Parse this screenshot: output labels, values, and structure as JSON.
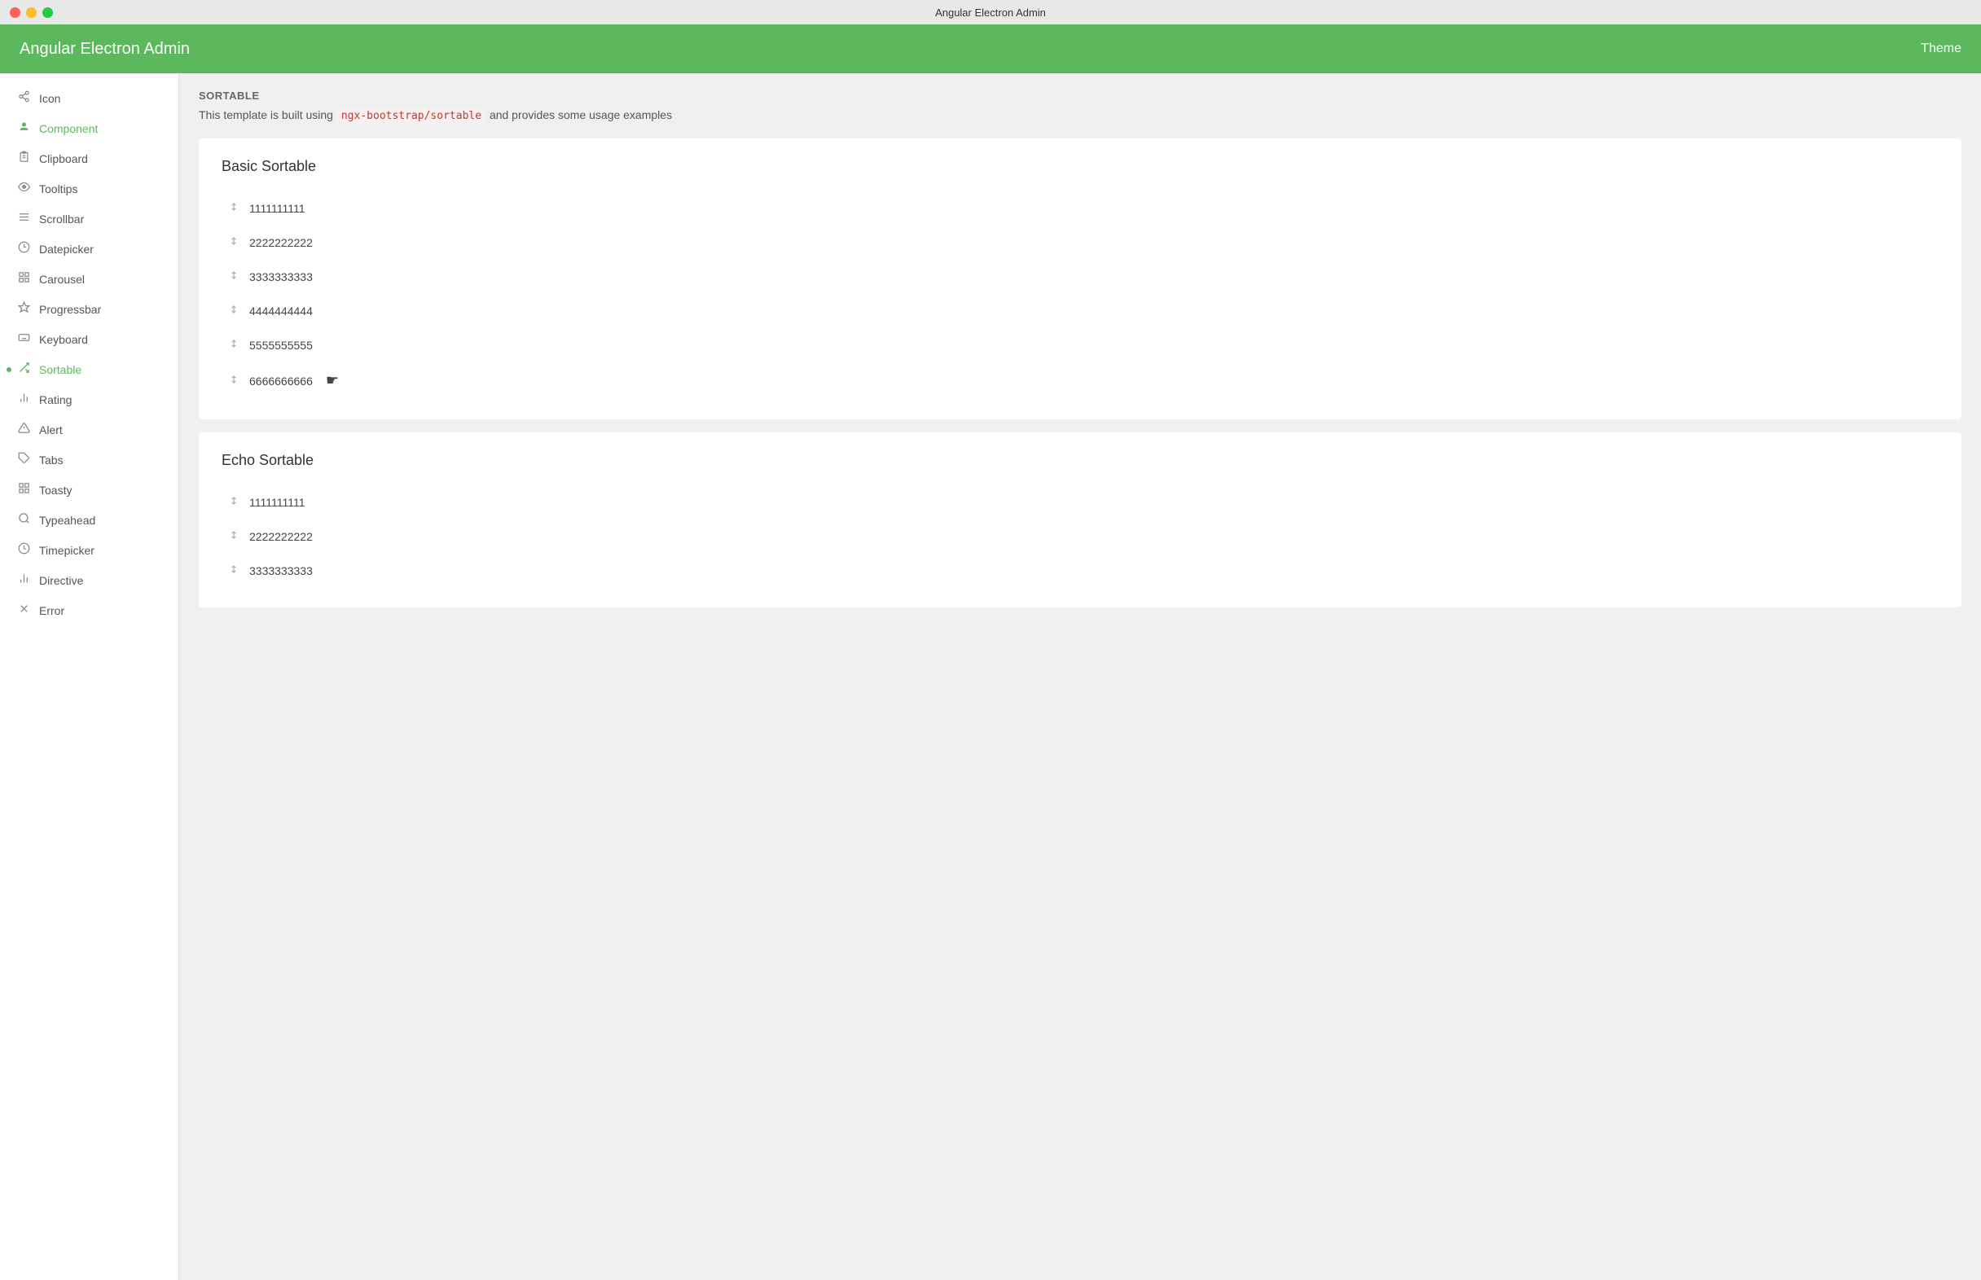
{
  "titlebar": {
    "title": "Angular Electron Admin"
  },
  "navbar": {
    "brand": "Angular Electron Admin",
    "theme_label": "Theme"
  },
  "sidebar": {
    "items": [
      {
        "id": "icon",
        "label": "Icon",
        "icon": "share",
        "active": false
      },
      {
        "id": "component",
        "label": "Component",
        "icon": "user",
        "active": true,
        "green": true
      },
      {
        "id": "clipboard",
        "label": "Clipboard",
        "icon": "clipboard",
        "active": false
      },
      {
        "id": "tooltips",
        "label": "Tooltips",
        "icon": "eye",
        "active": false
      },
      {
        "id": "scrollbar",
        "label": "Scrollbar",
        "icon": "menu",
        "active": false
      },
      {
        "id": "datepicker",
        "label": "Datepicker",
        "icon": "circle",
        "active": false
      },
      {
        "id": "carousel",
        "label": "Carousel",
        "icon": "grid",
        "active": false
      },
      {
        "id": "progressbar",
        "label": "Progressbar",
        "icon": "layers",
        "active": false
      },
      {
        "id": "keyboard",
        "label": "Keyboard",
        "icon": "keyboard",
        "active": false
      },
      {
        "id": "sortable",
        "label": "Sortable",
        "icon": "sort",
        "active": true,
        "dot": true
      },
      {
        "id": "rating",
        "label": "Rating",
        "icon": "star",
        "active": false
      },
      {
        "id": "alert",
        "label": "Alert",
        "icon": "warning",
        "active": false
      },
      {
        "id": "tabs",
        "label": "Tabs",
        "icon": "tag",
        "active": false
      },
      {
        "id": "toasty",
        "label": "Toasty",
        "icon": "grid2",
        "active": false
      },
      {
        "id": "typeahead",
        "label": "Typeahead",
        "icon": "grid3",
        "active": false
      },
      {
        "id": "timepicker",
        "label": "Timepicker",
        "icon": "clock",
        "active": false
      },
      {
        "id": "directive",
        "label": "Directive",
        "icon": "bar-chart",
        "active": false
      },
      {
        "id": "error",
        "label": "Error",
        "icon": "cross",
        "active": false
      }
    ]
  },
  "page": {
    "section_title": "SORTABLE",
    "description_text": "This template is built using",
    "description_code": "ngx-bootstrap/sortable",
    "description_suffix": "and provides some usage examples",
    "basic_sortable_title": "Basic Sortable",
    "echo_sortable_title": "Echo Sortable",
    "basic_items": [
      "1111111111",
      "2222222222",
      "3333333333",
      "4444444444",
      "5555555555",
      "6666666666"
    ],
    "echo_items": [
      "1111111111",
      "2222222222",
      "3333333333"
    ]
  },
  "icons": {
    "sort": "⇅",
    "share": "⬡",
    "clipboard": "📋",
    "user": "👤",
    "eye": "👁",
    "menu": "≡",
    "circle": "◎",
    "grid": "⊞",
    "layers": "⧉",
    "keyboard": "⌨",
    "sort_icon": "⇅",
    "star": "✦",
    "warning": "⚠",
    "tag": "🏷",
    "bar": "▊",
    "cross": "✕",
    "hand_cursor": "☛"
  }
}
